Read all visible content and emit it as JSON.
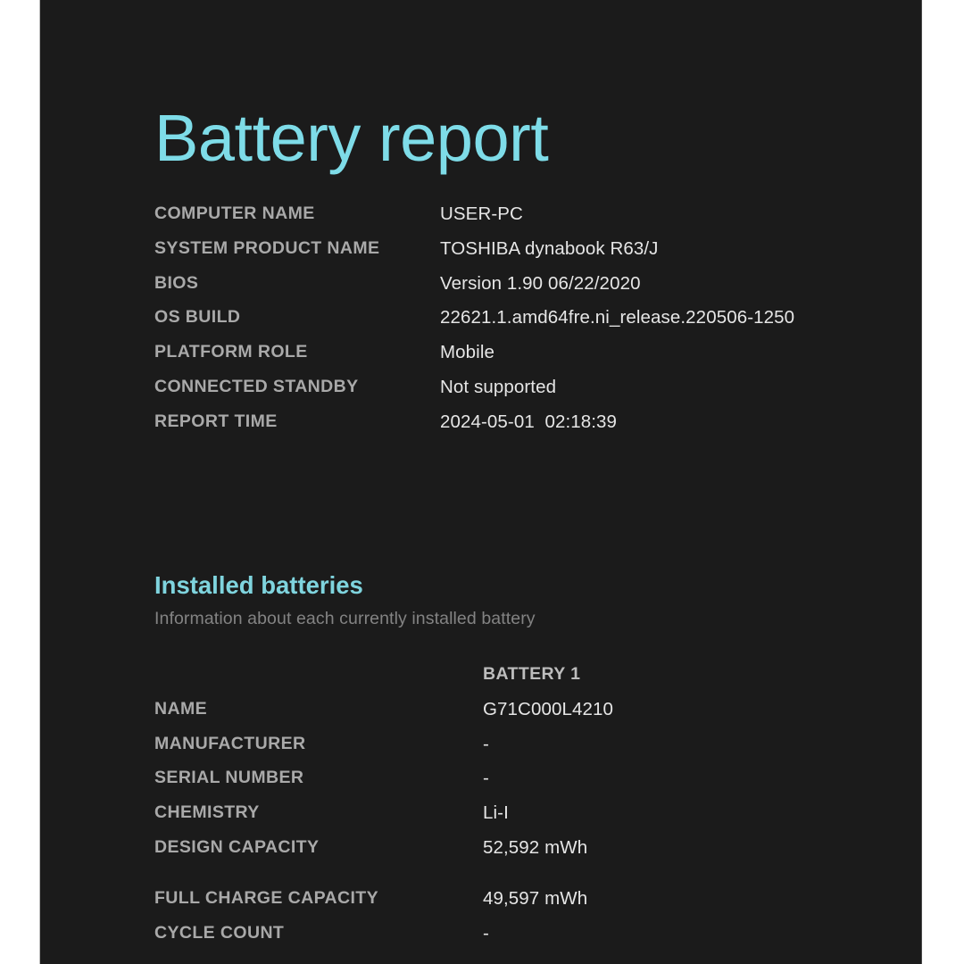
{
  "report": {
    "title": "Battery report",
    "accent_color": "#7edce8",
    "background_color": "#1b1b1b",
    "label_color": "#a9a9a9",
    "value_color": "#e6e6e6",
    "subheading_color": "#838383"
  },
  "system_info": {
    "rows": [
      {
        "label": "COMPUTER NAME",
        "value": "USER-PC"
      },
      {
        "label": "SYSTEM PRODUCT NAME",
        "value": "TOSHIBA dynabook R63/J"
      },
      {
        "label": "BIOS",
        "value": "Version 1.90 06/22/2020"
      },
      {
        "label": "OS BUILD",
        "value": "22621.1.amd64fre.ni_release.220506-1250"
      },
      {
        "label": "PLATFORM ROLE",
        "value": "Mobile"
      },
      {
        "label": "CONNECTED STANDBY",
        "value": "Not supported"
      },
      {
        "label": "REPORT TIME",
        "value": "2024-05-01  02:18:39"
      }
    ]
  },
  "installed_batteries": {
    "heading": "Installed batteries",
    "subheading": "Information about each currently installed battery",
    "column_header": "BATTERY 1",
    "rows": [
      {
        "label": "NAME",
        "value": "G71C000L4210"
      },
      {
        "label": "MANUFACTURER",
        "value": "-"
      },
      {
        "label": "SERIAL NUMBER",
        "value": "-"
      },
      {
        "label": "CHEMISTRY",
        "value": "Li-I"
      },
      {
        "label": "DESIGN CAPACITY",
        "value": "52,592 mWh"
      },
      {
        "label": "FULL CHARGE CAPACITY",
        "value": "49,597 mWh"
      },
      {
        "label": "CYCLE COUNT",
        "value": "-"
      }
    ]
  }
}
